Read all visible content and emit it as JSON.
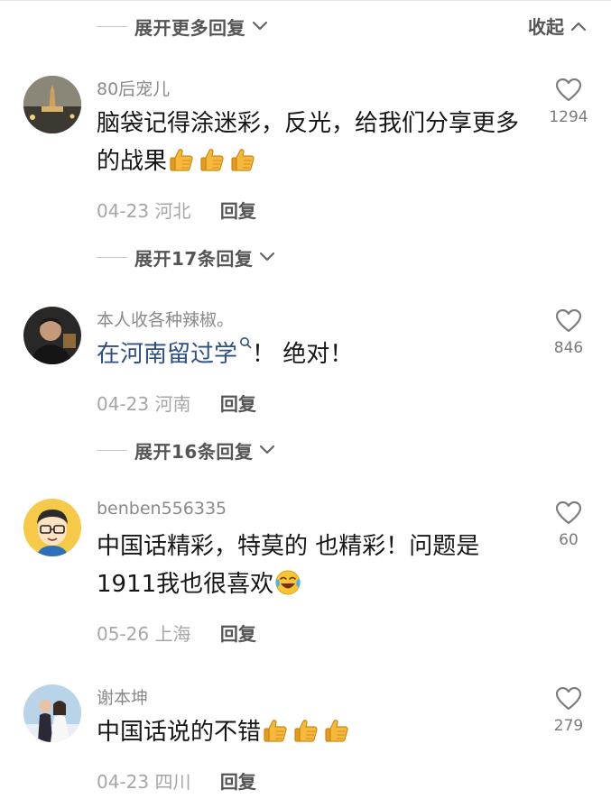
{
  "top_expand": {
    "label": "展开更多回复"
  },
  "collapse": {
    "label": "收起"
  },
  "comments": [
    {
      "username": "80后宠儿",
      "text": "脑袋记得涂迷彩，反光，给我们分享更多的战果",
      "emoji": "thumbs-up ×3",
      "date": "04-23",
      "location": "河北",
      "reply_label": "回复",
      "likes": "1294",
      "expand_label": "展开17条回复"
    },
    {
      "username": "本人收各种辣椒。",
      "text_link": "在河南留过学",
      "text_rest": "！ 绝对！",
      "date": "04-23",
      "location": "河南",
      "reply_label": "回复",
      "likes": "846",
      "expand_label": "展开16条回复"
    },
    {
      "username": "benben556335",
      "text": "中国话精彩，特莫的 也精彩！问题是1911我也很喜欢",
      "emoji": "laugh-cry",
      "date": "05-26",
      "location": "上海",
      "reply_label": "回复",
      "likes": "60"
    },
    {
      "username": "谢本坤",
      "text": "中国话说的不错",
      "emoji": "thumbs-up ×3",
      "date": "04-23",
      "location": "四川",
      "reply_label": "回复",
      "likes": "279"
    }
  ],
  "colors": {
    "link": "#2e4f86",
    "meta": "#a6a6a6",
    "username": "#8a8a8a"
  },
  "icons": [
    "heart-outline-icon",
    "chevron-down-icon",
    "chevron-up-icon",
    "search-mini-icon",
    "thumbs-up-emoji",
    "laugh-cry-emoji"
  ]
}
